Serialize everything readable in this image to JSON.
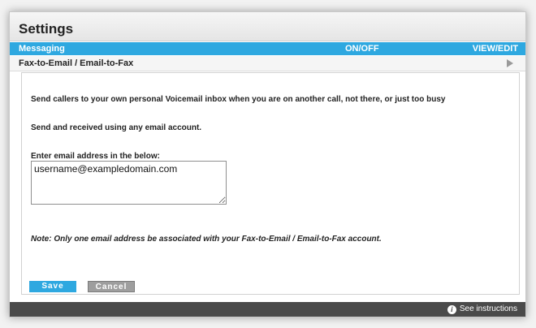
{
  "header": {
    "title": "Settings"
  },
  "tabbar": {
    "col1": "Messaging",
    "col2": "ON/OFF",
    "col3": "VIEW/EDIT"
  },
  "section": {
    "title": "Fax-to-Email / Email-to-Fax"
  },
  "content": {
    "line1": "Send callers to your own personal Voicemail inbox when you are on another call, not there, or just too busy",
    "line2": "Send and received using any email account.",
    "email_label": "Enter email address in the below:",
    "email_value": "username@exampledomain.com",
    "note": "Note:  Only one email address be associated with your Fax-to-Email / Email-to-Fax account."
  },
  "buttons": {
    "save": "Save",
    "cancel": "Cancel"
  },
  "footer": {
    "info_glyph": "i",
    "instructions": "See instructions"
  },
  "colors": {
    "accent": "#2ea8e0",
    "footer": "#4a4a4a",
    "cancel": "#9e9e9e"
  }
}
